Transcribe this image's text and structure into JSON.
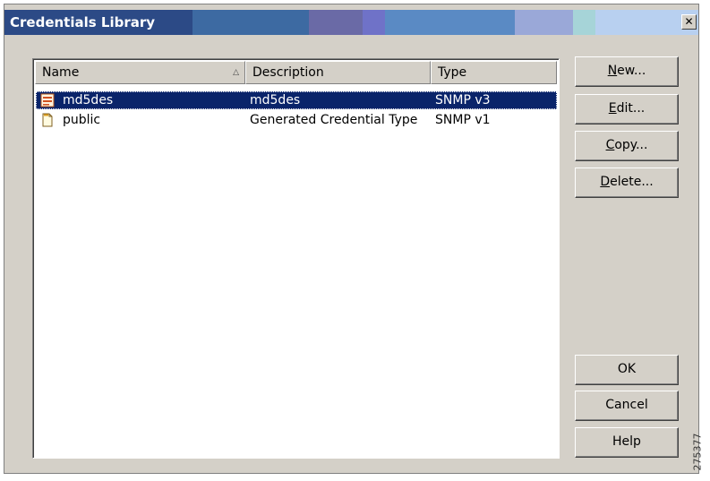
{
  "window": {
    "title": "Credentials Library",
    "close_glyph": "✕"
  },
  "list": {
    "columns": [
      {
        "label": "Name",
        "sort": "ascending"
      },
      {
        "label": "Description"
      },
      {
        "label": "Type"
      }
    ],
    "rows": [
      {
        "icon": "credential-list-icon",
        "name": "md5des",
        "description": "md5des",
        "type": "SNMP v3",
        "selected": true
      },
      {
        "icon": "document-icon",
        "name": "public",
        "description": "Generated Credential Type",
        "type": "SNMP v1",
        "selected": false
      }
    ]
  },
  "buttons": {
    "new": {
      "accel": "N",
      "rest": "ew..."
    },
    "edit": {
      "accel": "E",
      "rest": "dit..."
    },
    "copy": {
      "accel": "C",
      "rest": "opy..."
    },
    "delete": {
      "accel": "D",
      "rest": "elete..."
    },
    "ok": "OK",
    "cancel": "Cancel",
    "help": "Help"
  },
  "figure_id": "275377",
  "colors": {
    "selection": "#0a246a",
    "dialog_face": "#d4d0c8",
    "title_gradient": [
      "#2c4a86",
      "#3d6aa2",
      "#6a6aa6",
      "#5a8ac4",
      "#9aa8d8",
      "#a6d4d8",
      "#b8d0f0"
    ]
  }
}
